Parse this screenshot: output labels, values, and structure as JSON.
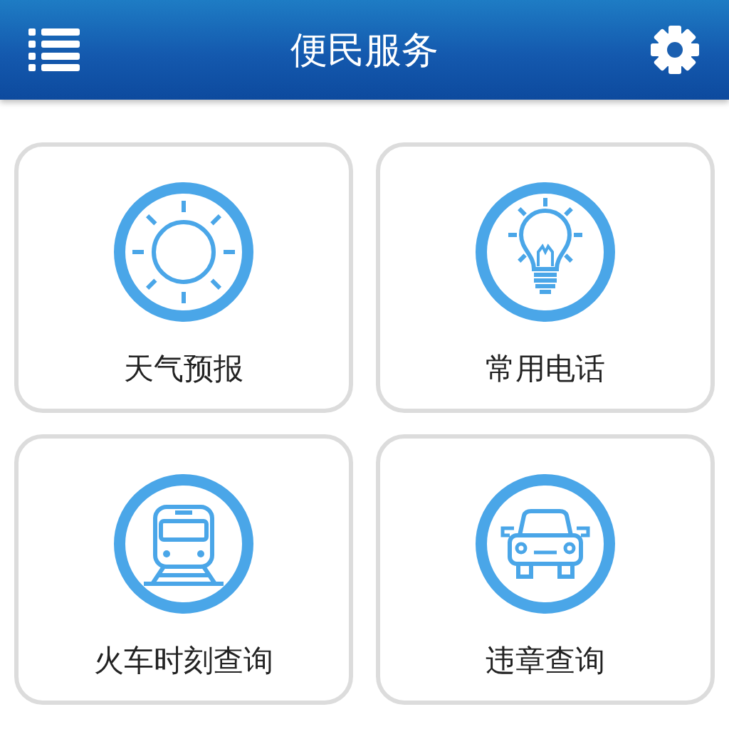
{
  "header": {
    "title": "便民服务"
  },
  "services": [
    {
      "label": "天气预报",
      "kind": "sun"
    },
    {
      "label": "常用电话",
      "kind": "bulb"
    },
    {
      "label": "火车时刻查询",
      "kind": "train"
    },
    {
      "label": "违章查询",
      "kind": "car"
    }
  ]
}
